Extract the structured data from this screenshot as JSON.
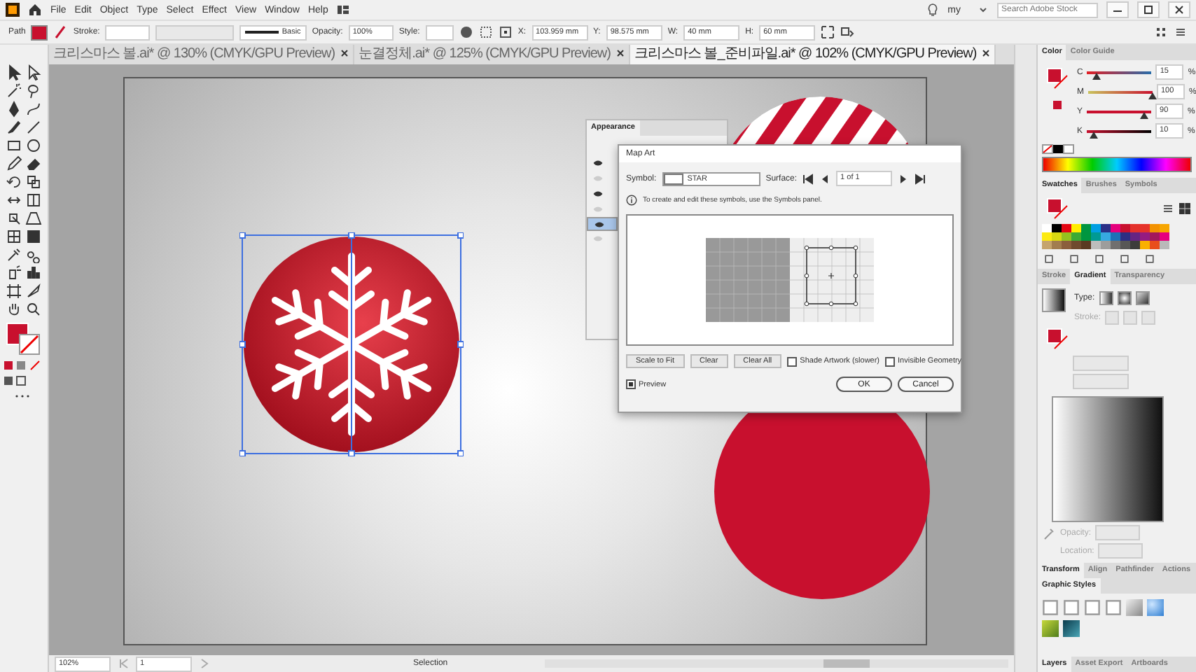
{
  "menu_bar": {
    "items": [
      "File",
      "Edit",
      "Object",
      "Type",
      "Select",
      "Effect",
      "View",
      "Window",
      "Help"
    ],
    "workspace": "my",
    "search": {
      "placeholder": "Search Adobe Stock"
    }
  },
  "control_bar": {
    "selection": "Path",
    "stroke_label": "Stroke:",
    "stroke_style": "Basic",
    "opacity_label": "Opacity:",
    "opacity": "100%",
    "style_label": "Style:",
    "fields": [
      {
        "label": "X:",
        "value": "103.959 mm"
      },
      {
        "label": "Y:",
        "value": "98.575 mm"
      },
      {
        "label": "W:",
        "value": "40 mm"
      },
      {
        "label": "H:",
        "value": "60 mm"
      }
    ]
  },
  "tabs": [
    {
      "label": "크리스마스 볼.ai* @ 130% (CMYK/GPU Preview)",
      "selected": false
    },
    {
      "label": "눈결정체.ai* @ 125% (CMYK/GPU Preview)",
      "selected": false
    },
    {
      "label": "크리스마스 볼_준비파일.ai* @ 102% (CMYK/GPU Preview)",
      "selected": true
    }
  ],
  "appearance_panel": {
    "title": "Appearance",
    "rows": [
      {
        "visible": true,
        "selected": false
      },
      {
        "visible": false,
        "selected": false
      },
      {
        "visible": true,
        "selected": false
      },
      {
        "visible": false,
        "selected": false
      },
      {
        "visible": true,
        "selected": true
      },
      {
        "visible": false,
        "selected": false
      }
    ]
  },
  "map_art_dialog": {
    "title": "Map Art",
    "symbol_label": "Symbol:",
    "symbol": "STAR",
    "surface_label": "Surface:",
    "surface": "1 of 1",
    "info": "To create and edit these symbols, use the Symbols panel.",
    "buttons": [
      "Scale to Fit",
      "Clear",
      "Clear All"
    ],
    "options": [
      {
        "label": "Shade Artwork (slower)",
        "checked": false
      },
      {
        "label": "Invisible Geometry",
        "checked": false
      }
    ],
    "preview": {
      "label": "Preview",
      "checked": true
    },
    "ok": "OK",
    "cancel": "Cancel"
  },
  "color_panel": {
    "tabs": [
      {
        "label": "Color",
        "selected": true
      },
      {
        "label": "Color Guide",
        "selected": false
      }
    ],
    "sliders": [
      {
        "name": "C",
        "level": 0.15,
        "value": "15",
        "unit": "%"
      },
      {
        "name": "M",
        "level": 1.0,
        "value": "100",
        "unit": "%"
      },
      {
        "name": "Y",
        "level": 0.9,
        "value": "90",
        "unit": "%"
      },
      {
        "name": "K",
        "level": 0.1,
        "value": "10",
        "unit": "%"
      }
    ]
  },
  "swatches_panel": {
    "tabs": [
      {
        "label": "Swatches",
        "selected": true
      },
      {
        "label": "Brushes",
        "selected": false
      },
      {
        "label": "Symbols",
        "selected": false
      }
    ],
    "swatches": [
      {
        "color": "#ffffff"
      },
      {
        "color": "#000000"
      },
      {
        "color": "#e30613"
      },
      {
        "color": "#ffed00"
      },
      {
        "color": "#009640"
      },
      {
        "color": "#00a0e3"
      },
      {
        "color": "#2a2f87"
      },
      {
        "color": "#e5007d"
      },
      {
        "color": "#c8102e"
      },
      {
        "color": "#e4312b"
      },
      {
        "color": "#e6332a"
      },
      {
        "color": "#f39200"
      },
      {
        "color": "#f7a600"
      },
      {
        "color": "#fcea10"
      },
      {
        "color": "#d8d812"
      },
      {
        "color": "#95c11f"
      },
      {
        "color": "#3aaa35"
      },
      {
        "color": "#00963f"
      },
      {
        "color": "#009a93"
      },
      {
        "color": "#36a9e1"
      },
      {
        "color": "#1d71b8"
      },
      {
        "color": "#2d2e83"
      },
      {
        "color": "#662483"
      },
      {
        "color": "#951b81"
      },
      {
        "color": "#a3195b"
      },
      {
        "color": "#e6007e"
      },
      {
        "color": "#c5a46d"
      },
      {
        "color": "#a27d4f"
      },
      {
        "color": "#8b5e3c"
      },
      {
        "color": "#6f4a2e"
      },
      {
        "color": "#5a3a22"
      },
      {
        "color": "#bdbdbd"
      },
      {
        "color": "#9d9d9c"
      },
      {
        "color": "#706f6f"
      },
      {
        "color": "#575756"
      },
      {
        "color": "#3c3c3b"
      },
      {
        "color": "#f9b000"
      },
      {
        "color": "#e94e1b"
      },
      {
        "color": "#b9b9b9"
      }
    ]
  },
  "gradient_panel": {
    "tabs": [
      {
        "label": "Stroke",
        "selected": false
      },
      {
        "label": "Gradient",
        "selected": true
      },
      {
        "label": "Transparency",
        "selected": false
      }
    ],
    "type_label": "Type:",
    "stroke_label": "Stroke:",
    "opacity_label": "Opacity:",
    "location_label": "Location:"
  },
  "transform_tabs": [
    {
      "label": "Transform",
      "selected": true
    },
    {
      "label": "Align",
      "selected": false
    },
    {
      "label": "Pathfinder",
      "selected": false
    },
    {
      "label": "Actions",
      "selected": false
    }
  ],
  "graphic_styles": {
    "title": "Graphic Styles"
  },
  "layers_tabs": [
    {
      "label": "Layers",
      "selected": true
    },
    {
      "label": "Asset Export",
      "selected": false
    },
    {
      "label": "Artboards",
      "selected": false
    }
  ],
  "status_bar": {
    "zoom": "102%",
    "artboard": "1",
    "tool": "Selection"
  }
}
